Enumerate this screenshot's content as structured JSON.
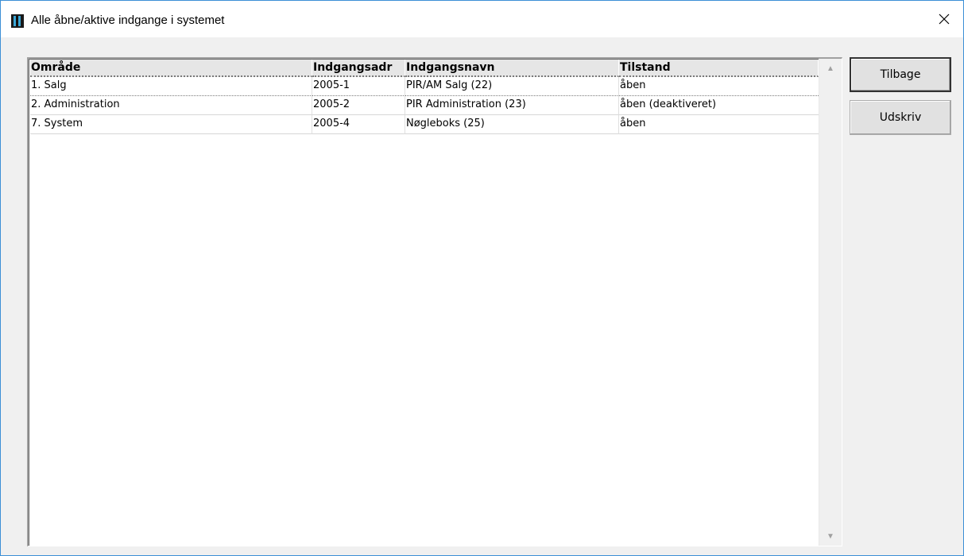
{
  "window": {
    "title": "Alle åbne/aktive indgange i systemet",
    "icon": "app-icon",
    "close_icon": "close-icon",
    "border_color": "#3c8fd6"
  },
  "table": {
    "columns": [
      "Område",
      "Indgangsadr",
      "Indgangsnavn",
      "Tilstand"
    ],
    "rows": [
      [
        "1. Salg",
        "2005-1",
        "PIR/AM Salg (22)",
        "åben"
      ],
      [
        "2. Administration",
        "2005-2",
        "PIR Administration (23)",
        "åben (deaktiveret)"
      ],
      [
        "7. System",
        "2005-4",
        "Nøgleboks (25)",
        "åben"
      ]
    ]
  },
  "buttons": {
    "back_label": "Tilbage",
    "print_label": "Udskriv"
  }
}
